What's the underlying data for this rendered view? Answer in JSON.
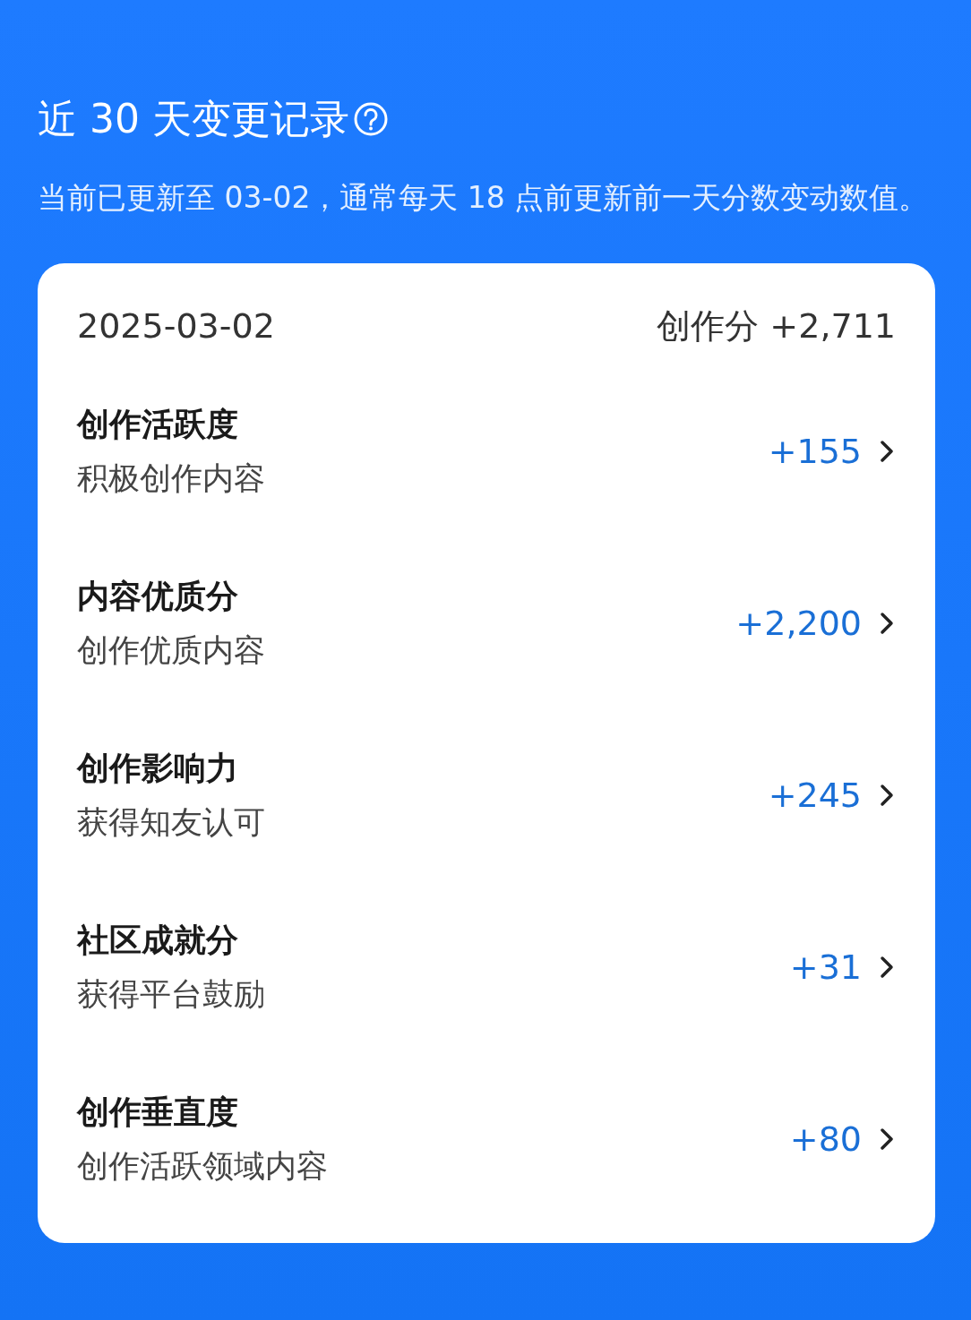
{
  "header": {
    "title": "近 30 天变更记录",
    "description": "当前已更新至 03-02，通常每天 18 点前更新前一天分数变动数值。"
  },
  "record": {
    "date": "2025-03-02",
    "total": "创作分 +2,711",
    "items": [
      {
        "title": "创作活跃度",
        "subtitle": "积极创作内容",
        "value": "+155"
      },
      {
        "title": "内容优质分",
        "subtitle": "创作优质内容",
        "value": "+2,200"
      },
      {
        "title": "创作影响力",
        "subtitle": "获得知友认可",
        "value": "+245"
      },
      {
        "title": "社区成就分",
        "subtitle": "获得平台鼓励",
        "value": "+31"
      },
      {
        "title": "创作垂直度",
        "subtitle": "创作活跃领域内容",
        "value": "+80"
      }
    ]
  }
}
